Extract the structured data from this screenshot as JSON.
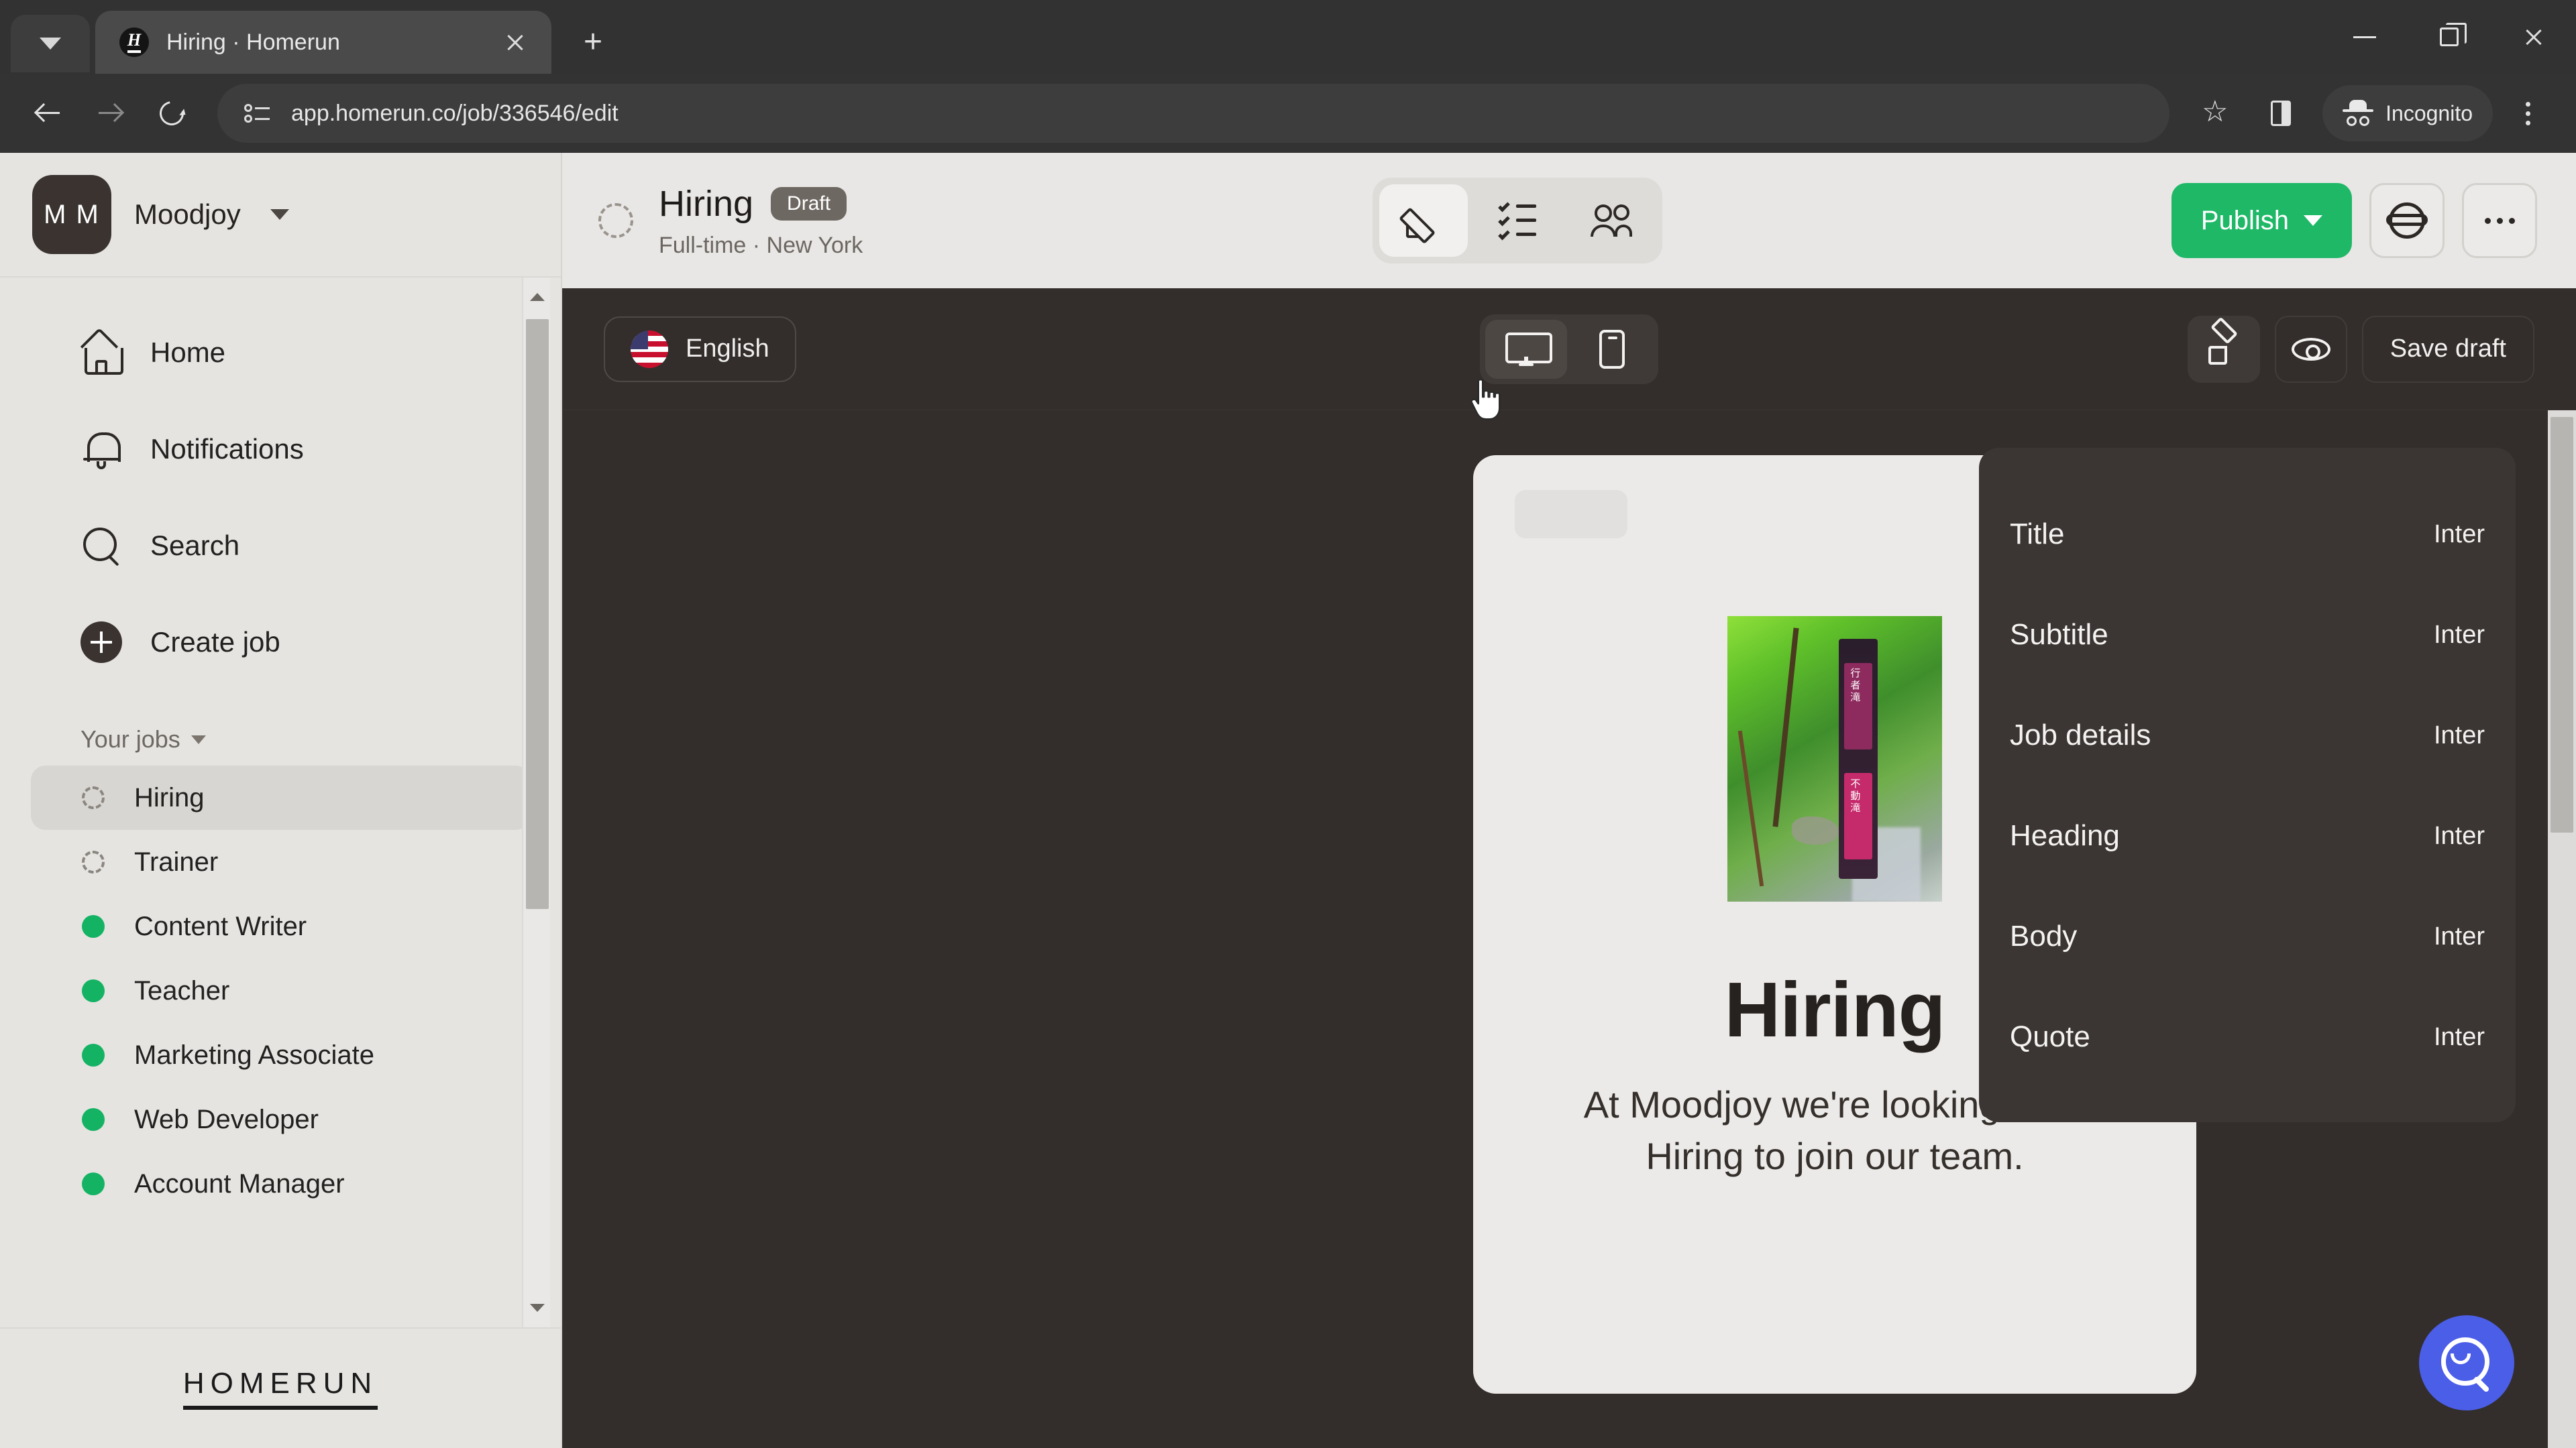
{
  "browser": {
    "tab": {
      "title": "Hiring · Homerun",
      "favicon_letter": "H"
    },
    "tab_search_icon": "chevron-down-icon",
    "new_tab_label": "+",
    "url": "app.homerun.co/job/336546/edit",
    "profile_label": "Incognito",
    "window_controls": {
      "minimize": "minimize",
      "maximize": "maximize",
      "close": "close"
    }
  },
  "sidebar": {
    "org": {
      "initials": "M M",
      "name": "Moodjoy"
    },
    "nav": [
      {
        "label": "Home",
        "icon": "home-icon"
      },
      {
        "label": "Notifications",
        "icon": "bell-icon"
      },
      {
        "label": "Search",
        "icon": "search-icon"
      },
      {
        "label": "Create job",
        "icon": "plus-circle-icon"
      }
    ],
    "section_label": "Your jobs",
    "jobs": [
      {
        "label": "Hiring",
        "status": "draft",
        "active": true
      },
      {
        "label": "Trainer",
        "status": "draft",
        "active": false
      },
      {
        "label": "Content Writer",
        "status": "live",
        "active": false
      },
      {
        "label": "Teacher",
        "status": "live",
        "active": false
      },
      {
        "label": "Marketing Associate",
        "status": "live",
        "active": false
      },
      {
        "label": "Web Developer",
        "status": "live",
        "active": false
      },
      {
        "label": "Account Manager",
        "status": "live",
        "active": false
      }
    ],
    "footer_logo": "HOMERUN"
  },
  "job_header": {
    "title": "Hiring",
    "badge": "Draft",
    "subtitle": "Full-time · New York",
    "view_tabs": [
      {
        "name": "edit",
        "icon": "pencil-icon",
        "active": true
      },
      {
        "name": "checklist",
        "icon": "checklist-icon",
        "active": false
      },
      {
        "name": "candidates",
        "icon": "people-icon",
        "active": false
      }
    ],
    "publish_label": "Publish",
    "settings_icon": "gear-icon",
    "more_icon": "more-dots-icon"
  },
  "editor_toolbar": {
    "language": "English",
    "language_flag": "us-flag-icon",
    "devices": [
      {
        "name": "desktop",
        "icon": "monitor-icon",
        "active": true
      },
      {
        "name": "mobile",
        "icon": "mobile-icon",
        "active": false
      }
    ],
    "brush_icon": "brush-icon",
    "preview_icon": "eye-icon",
    "save_label": "Save draft"
  },
  "preview": {
    "title": "Hiring",
    "subtitle": "At Moodjoy we're looking for a Hiring to join our team.",
    "photo_alt": "forest-signpost-photo",
    "photo_text_top": "行者滝",
    "photo_text_bottom": "不動滝"
  },
  "typography_panel": {
    "rows": [
      {
        "name": "Title",
        "font": "Inter"
      },
      {
        "name": "Subtitle",
        "font": "Inter"
      },
      {
        "name": "Job details",
        "font": "Inter"
      },
      {
        "name": "Heading",
        "font": "Inter"
      },
      {
        "name": "Body",
        "font": "Inter"
      },
      {
        "name": "Quote",
        "font": "Inter"
      }
    ]
  },
  "help_fab": {
    "icon": "search-smile-icon"
  },
  "colors": {
    "publish_green": "#1fb867",
    "status_green": "#14b364",
    "editor_dark": "#332e2c",
    "panel_dark": "#3b3633",
    "fab_blue": "#4b5ee8",
    "app_bg": "#e8e7e5"
  }
}
